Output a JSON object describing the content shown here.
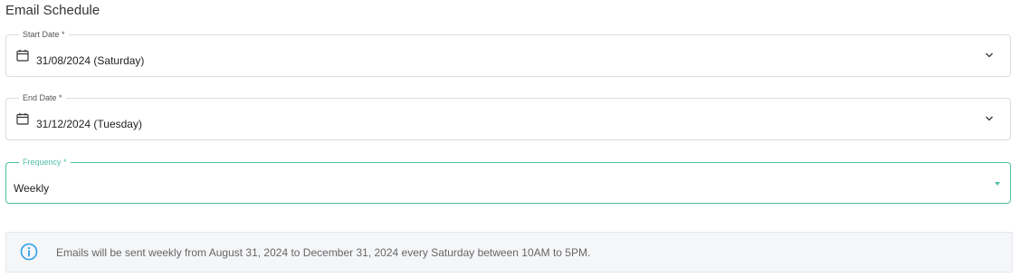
{
  "section": {
    "title": "Email Schedule"
  },
  "start_date": {
    "label": "Start Date *",
    "value": "31/08/2024 (Saturday)",
    "icon": "calendar-icon"
  },
  "end_date": {
    "label": "End Date *",
    "value": "31/12/2024 (Tuesday)",
    "icon": "calendar-icon"
  },
  "frequency": {
    "label": "Frequency *",
    "value": "Weekly"
  },
  "info": {
    "icon": "info-icon",
    "text": "Emails will be sent weekly from August 31, 2024 to December 31, 2024 every Saturday between 10AM to 5PM."
  },
  "colors": {
    "accent": "#4fbfa5",
    "info_icon": "#2e9ee6",
    "border": "#dcdcdc"
  }
}
